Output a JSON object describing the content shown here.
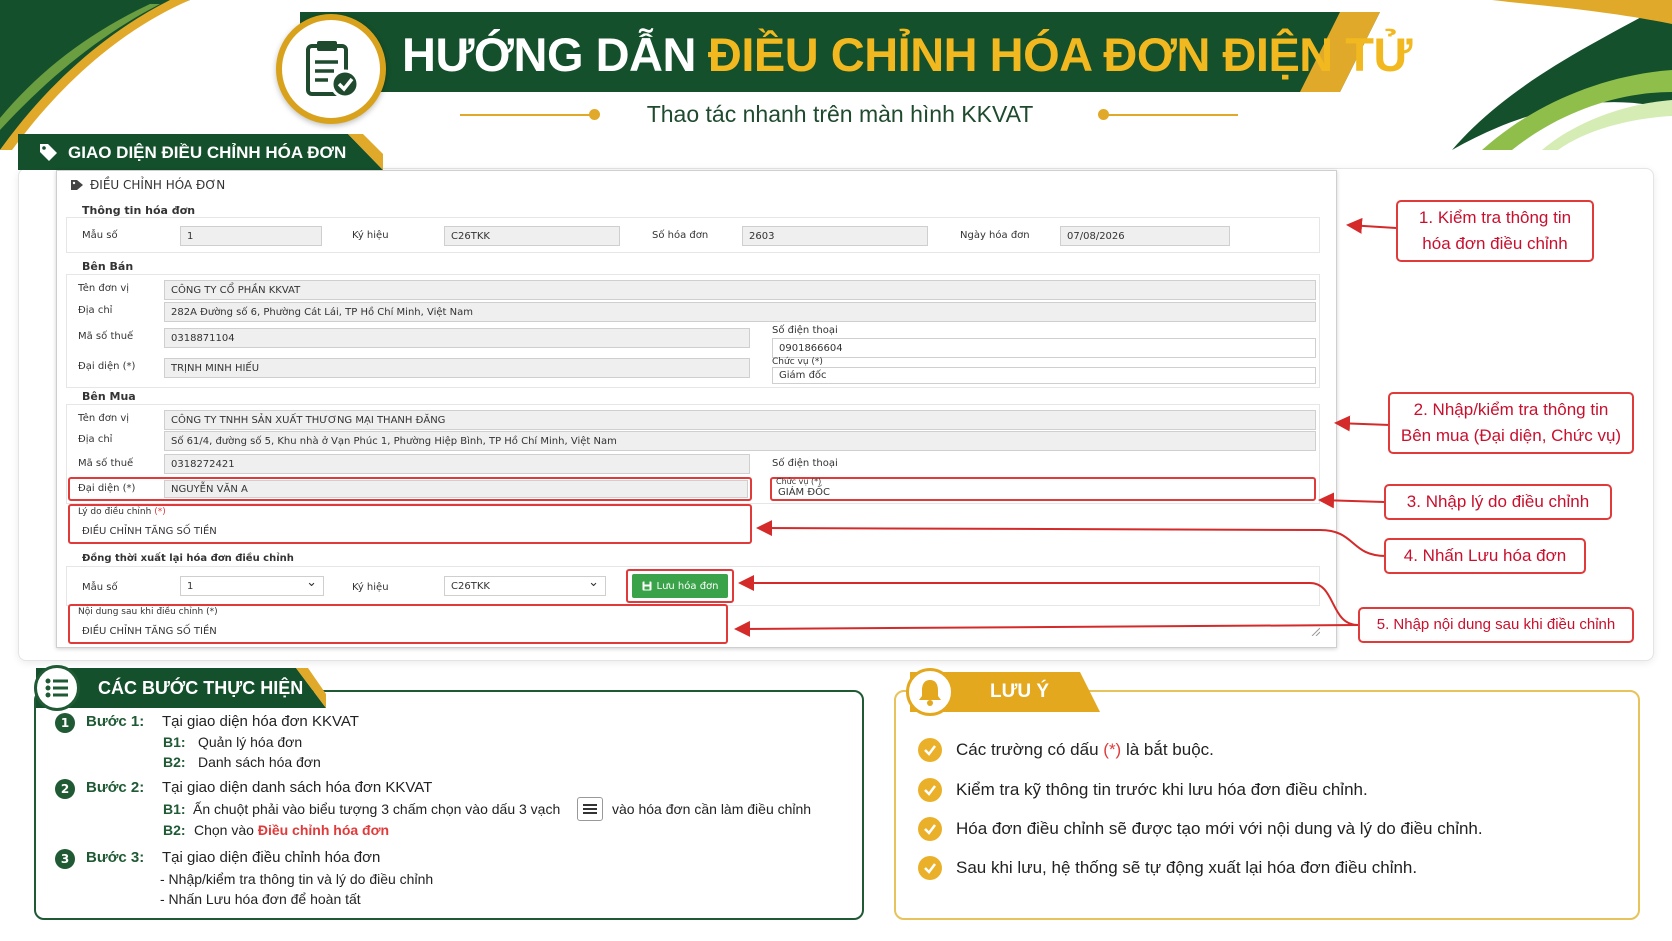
{
  "header": {
    "title_white": "HƯỚNG DẪN",
    "title_yellow": "ĐIỀU CHỈNH HÓA ĐƠN ĐIỆN TỬ",
    "subtitle": "Thao tác nhanh trên màn hình KKVAT",
    "icon": "clipboard-check-icon"
  },
  "section": {
    "tab_label": "GIAO DIỆN ĐIỀU CHỈNH HÓA ĐƠN",
    "icon": "tags-icon"
  },
  "form": {
    "heading": "ĐIỀU CHỈNH HÓA ĐƠN",
    "invoice_info": {
      "title": "Thông tin hóa đơn",
      "mau_so_label": "Mẫu số",
      "mau_so_value": "1",
      "ky_hieu_label": "Ký hiệu",
      "ky_hieu_value": "C26TKK",
      "so_hoa_don_label": "Số hóa đơn",
      "so_hoa_don_value": "2603",
      "ngay_label": "Ngày hóa đơn",
      "ngay_value": "07/08/2026"
    },
    "seller": {
      "title": "Bên Bán",
      "ten_label": "Tên đơn vị",
      "ten_value": "CÔNG TY CỔ PHẦN KKVAT",
      "dia_chi_label": "Địa chỉ",
      "dia_chi_value": "282A Đường số 6, Phường Cát Lái, TP Hồ Chí Minh, Việt Nam",
      "mst_label": "Mã số thuế",
      "mst_value": "0318871104",
      "sdt_label": "Số điện thoại",
      "sdt_value": "0901866604",
      "dai_dien_label": "Đại diện (*)",
      "dai_dien_value": "TRỊNH MINH HIẾU",
      "chuc_vu_label": "Chức vụ (*)",
      "chuc_vu_value": "Giám đốc"
    },
    "buyer": {
      "title": "Bên Mua",
      "ten_label": "Tên đơn vị",
      "ten_value": "CÔNG TY TNHH SẢN XUẤT THƯƠNG MẠI THANH ĐĂNG",
      "dia_chi_label": "Địa chỉ",
      "dia_chi_value": "Số 61/4, đường số 5, Khu nhà ở Vạn Phúc 1, Phường Hiệp Bình, TP Hồ Chí Minh, Việt Nam",
      "mst_label": "Mã số thuế",
      "mst_value": "0318272421",
      "sdt_label": "Số điện thoại",
      "sdt_value": "",
      "dai_dien_label": "Đại diện (*)",
      "dai_dien_value": "NGUYỄN VĂN A",
      "chuc_vu_label": "Chức vụ (*)",
      "chuc_vu_value": "GIÁM ĐỐC"
    },
    "ly_do_label": "Lý do điều chỉnh",
    "ly_do_star": "(*)",
    "ly_do_value": "ĐIỀU CHỈNH TĂNG SỐ TIỀN",
    "reissue": {
      "title": "Đồng thời xuất lại hóa đơn điều chỉnh",
      "mau_so_label": "Mẫu số",
      "mau_so_value": "1",
      "ky_hieu_label": "Ký hiệu",
      "ky_hieu_value": "C26TKK",
      "save_button": "Lưu hóa đơn"
    },
    "noi_dung_label": "Nội dung sau khi điều chỉnh (*)",
    "noi_dung_value": "ĐIỀU CHỈNH TĂNG SỐ TIỀN"
  },
  "callouts": [
    {
      "line1": "1.  Kiểm tra thông tin",
      "line2": "hóa đơn điều chỉnh"
    },
    {
      "line1": "2.  Nhập/kiểm tra thông tin",
      "line2": "Bên mua (Đại diện, Chức vụ)"
    },
    {
      "line1": "3.  Nhập lý do điều chỉnh",
      "line2": ""
    },
    {
      "line1": "4.  Nhấn Lưu hóa đơn",
      "line2": ""
    },
    {
      "line1": "5.  Nhập nội dung sau khi điều chỉnh",
      "line2": ""
    }
  ],
  "steps": {
    "title": "CÁC BƯỚC THỰC HIỆN",
    "icon": "list-icon",
    "items": [
      {
        "num": "1",
        "label": "Bước 1:",
        "text": "Tại giao diện hóa đơn KKVAT",
        "subs": [
          {
            "label": "B1:",
            "text": "Quản lý hóa đơn"
          },
          {
            "label": "B2:",
            "text": "Danh sách hóa đơn"
          }
        ]
      },
      {
        "num": "2",
        "label": "Bước 2:",
        "text": "Tại giao diện danh sách hóa đơn KKVAT",
        "b1_label": "B1:",
        "b1_text_a": "Ấn chuột phải vào biểu tượng 3 chấm chọn vào dấu 3 vạch",
        "b1_text_b": "vào hóa đơn cần làm điều chỉnh",
        "b2_label": "B2:",
        "b2_text_a": "Chọn vào",
        "b2_text_b": "Điều chỉnh hóa đơn"
      },
      {
        "num": "3",
        "label": "Bước 3:",
        "text": "Tại giao diện điều chỉnh hóa đơn",
        "lines": [
          "- Nhập/kiểm tra thông tin và lý do điều chỉnh",
          "- Nhấn Lưu hóa đơn để hoàn tất"
        ]
      }
    ]
  },
  "notes": {
    "title": "LƯU Ý",
    "icon": "bell-icon",
    "item1_a": "Các trường có dấu",
    "item1_star": "(*)",
    "item1_b": "là bắt buộc.",
    "item2": "Kiểm tra kỹ thông tin trước khi lưu hóa đơn điều chỉnh.",
    "item3": "Hóa đơn điều chỉnh sẽ được tạo mới với nội dung và lý do điều chỉnh.",
    "item4": "Sau khi lưu, hệ thống sẽ tự động xuất lại hóa đơn điều chỉnh."
  },
  "colors": {
    "green": "#1f5a35",
    "gold": "#e3a81e",
    "red": "#e03a3a"
  }
}
